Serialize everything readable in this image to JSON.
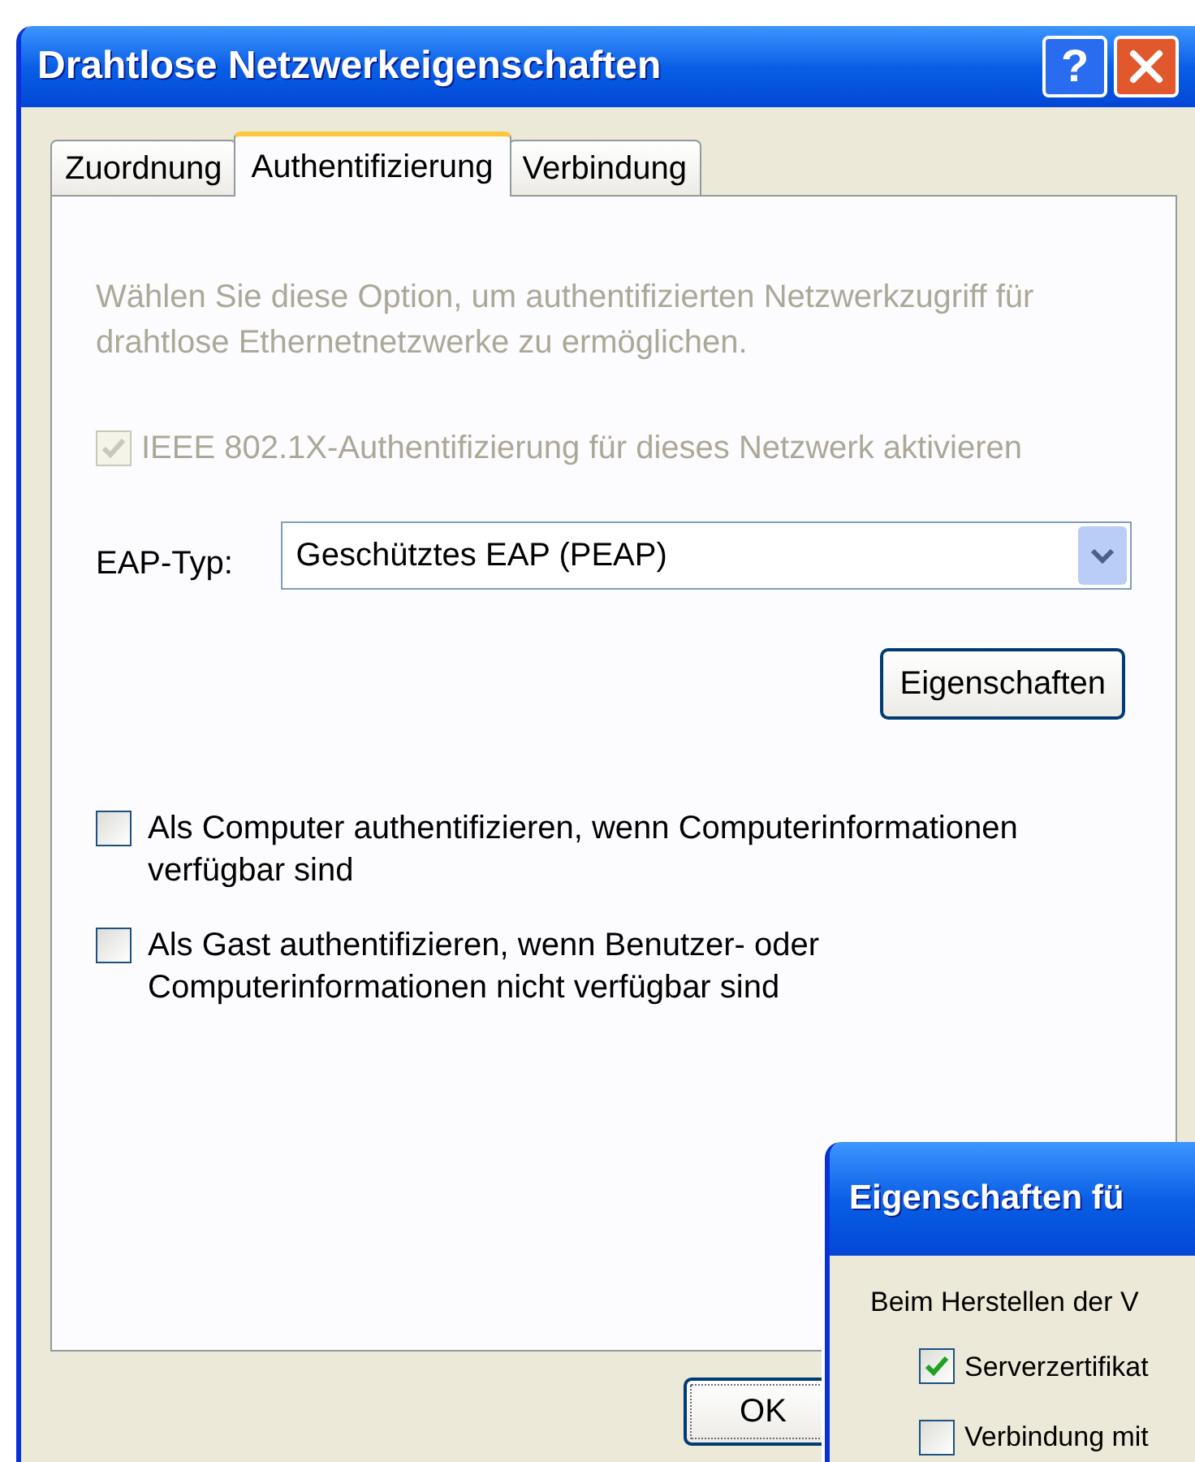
{
  "window": {
    "title": "Drahtlose Netzwerkeigenschaften",
    "help_button": "?"
  },
  "tabs": [
    {
      "label": "Zuordnung",
      "selected": false
    },
    {
      "label": "Authentifizierung",
      "selected": true
    },
    {
      "label": "Verbindung",
      "selected": false
    }
  ],
  "description": "Wählen Sie diese Option, um authentifizierten Netzwerkzugriff für drahtlose Ethernetnetzwerke zu ermöglichen.",
  "ieee_option": {
    "label": "IEEE 802.1X-Authentifizierung für dieses Netzwerk aktivieren",
    "checked": true,
    "disabled": true
  },
  "eap_type": {
    "label": "EAP-Typ:",
    "value": "Geschütztes EAP (PEAP)"
  },
  "properties_button": "Eigenschaften",
  "options": [
    {
      "label": "Als Computer authentifizieren, wenn Computerinformationen verfügbar sind",
      "checked": false
    },
    {
      "label": "Als Gast authentifizieren, wenn Benutzer- oder Computerinformationen nicht verfügbar sind",
      "checked": false
    }
  ],
  "ok_button": "OK",
  "overlay_dialog": {
    "title": "Eigenschaften fü",
    "intro": "Beim Herstellen der V",
    "options": [
      {
        "label": "Serverzertifikat",
        "checked": true
      },
      {
        "label": "Verbindung mit",
        "checked": false
      }
    ]
  }
}
